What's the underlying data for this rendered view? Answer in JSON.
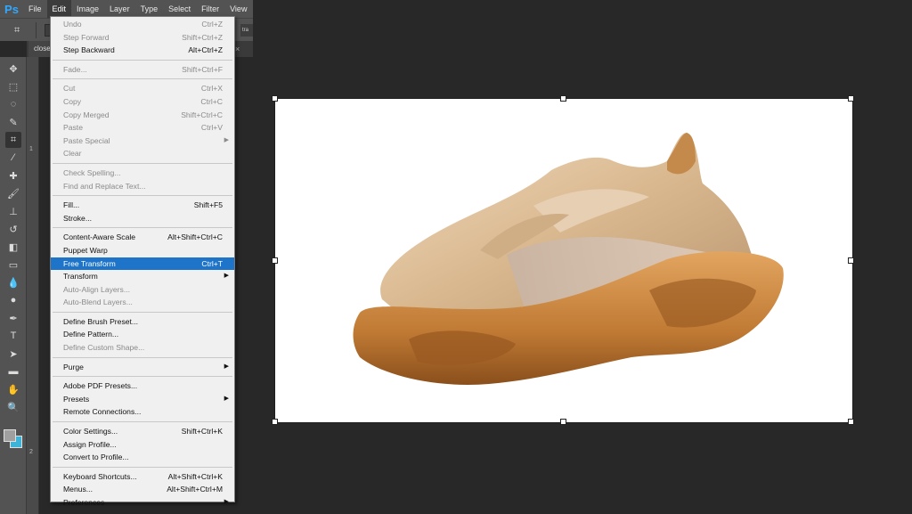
{
  "app": {
    "logo": "Ps"
  },
  "menubar": [
    "File",
    "Edit",
    "Image",
    "Layer",
    "Type",
    "Select",
    "Filter",
    "View"
  ],
  "document": {
    "tab_label": "close",
    "tab_close": "×"
  },
  "optionsbar": {
    "right_label": "tra"
  },
  "ruler": [
    "1",
    "2"
  ],
  "edit_menu": [
    {
      "label": "Undo",
      "shortcut": "Ctrl+Z",
      "enabled": false
    },
    {
      "label": "Step Forward",
      "shortcut": "Shift+Ctrl+Z",
      "enabled": false
    },
    {
      "label": "Step Backward",
      "shortcut": "Alt+Ctrl+Z",
      "enabled": true
    },
    {
      "divider": true
    },
    {
      "label": "Fade...",
      "shortcut": "Shift+Ctrl+F",
      "enabled": false
    },
    {
      "divider": true
    },
    {
      "label": "Cut",
      "shortcut": "Ctrl+X",
      "enabled": false
    },
    {
      "label": "Copy",
      "shortcut": "Ctrl+C",
      "enabled": false
    },
    {
      "label": "Copy Merged",
      "shortcut": "Shift+Ctrl+C",
      "enabled": false
    },
    {
      "label": "Paste",
      "shortcut": "Ctrl+V",
      "enabled": false
    },
    {
      "label": "Paste Special",
      "submenu": true,
      "enabled": false
    },
    {
      "label": "Clear",
      "enabled": false
    },
    {
      "divider": true
    },
    {
      "label": "Check Spelling...",
      "enabled": false
    },
    {
      "label": "Find and Replace Text...",
      "enabled": false
    },
    {
      "divider": true
    },
    {
      "label": "Fill...",
      "shortcut": "Shift+F5",
      "enabled": true
    },
    {
      "label": "Stroke...",
      "enabled": true
    },
    {
      "divider": true
    },
    {
      "label": "Content-Aware Scale",
      "shortcut": "Alt+Shift+Ctrl+C",
      "enabled": true
    },
    {
      "label": "Puppet Warp",
      "enabled": true
    },
    {
      "label": "Free Transform",
      "shortcut": "Ctrl+T",
      "enabled": true,
      "highlighted": true
    },
    {
      "label": "Transform",
      "submenu": true,
      "enabled": true
    },
    {
      "label": "Auto-Align Layers...",
      "enabled": false
    },
    {
      "label": "Auto-Blend Layers...",
      "enabled": false
    },
    {
      "divider": true
    },
    {
      "label": "Define Brush Preset...",
      "enabled": true
    },
    {
      "label": "Define Pattern...",
      "enabled": true
    },
    {
      "label": "Define Custom Shape...",
      "enabled": false
    },
    {
      "divider": true
    },
    {
      "label": "Purge",
      "submenu": true,
      "enabled": true
    },
    {
      "divider": true
    },
    {
      "label": "Adobe PDF Presets...",
      "enabled": true
    },
    {
      "label": "Presets",
      "submenu": true,
      "enabled": true
    },
    {
      "label": "Remote Connections...",
      "enabled": true
    },
    {
      "divider": true
    },
    {
      "label": "Color Settings...",
      "shortcut": "Shift+Ctrl+K",
      "enabled": true
    },
    {
      "label": "Assign Profile...",
      "enabled": true
    },
    {
      "label": "Convert to Profile...",
      "enabled": true
    },
    {
      "divider": true
    },
    {
      "label": "Keyboard Shortcuts...",
      "shortcut": "Alt+Shift+Ctrl+K",
      "enabled": true
    },
    {
      "label": "Menus...",
      "shortcut": "Alt+Shift+Ctrl+M",
      "enabled": true
    },
    {
      "label": "Preferences",
      "submenu": true,
      "enabled": true
    }
  ],
  "tools": [
    {
      "icon": "move-icon",
      "glyph": "✥"
    },
    {
      "icon": "marquee-icon",
      "glyph": "⬚"
    },
    {
      "icon": "lasso-icon",
      "glyph": "◌"
    },
    {
      "icon": "quick-select-icon",
      "glyph": "✎"
    },
    {
      "icon": "crop-icon",
      "glyph": "⌗",
      "selected": true
    },
    {
      "icon": "eyedropper-icon",
      "glyph": "⁄"
    },
    {
      "icon": "healing-icon",
      "glyph": "✚"
    },
    {
      "icon": "brush-icon",
      "glyph": "🖌"
    },
    {
      "icon": "stamp-icon",
      "glyph": "⊥"
    },
    {
      "icon": "history-brush-icon",
      "glyph": "↺"
    },
    {
      "icon": "eraser-icon",
      "glyph": "◧"
    },
    {
      "icon": "gradient-icon",
      "glyph": "▭"
    },
    {
      "icon": "blur-icon",
      "glyph": "💧"
    },
    {
      "icon": "dodge-icon",
      "glyph": "●"
    },
    {
      "icon": "pen-icon",
      "glyph": "✒"
    },
    {
      "icon": "type-icon",
      "glyph": "T"
    },
    {
      "icon": "path-select-icon",
      "glyph": "➤"
    },
    {
      "icon": "rectangle-icon",
      "glyph": "▬"
    },
    {
      "icon": "hand-icon",
      "glyph": "✋"
    },
    {
      "icon": "zoom-icon",
      "glyph": "🔍"
    }
  ],
  "colors": {
    "foreground": "#a0a0a0",
    "background": "#3db3d8",
    "highlight": "#1e74c8"
  }
}
